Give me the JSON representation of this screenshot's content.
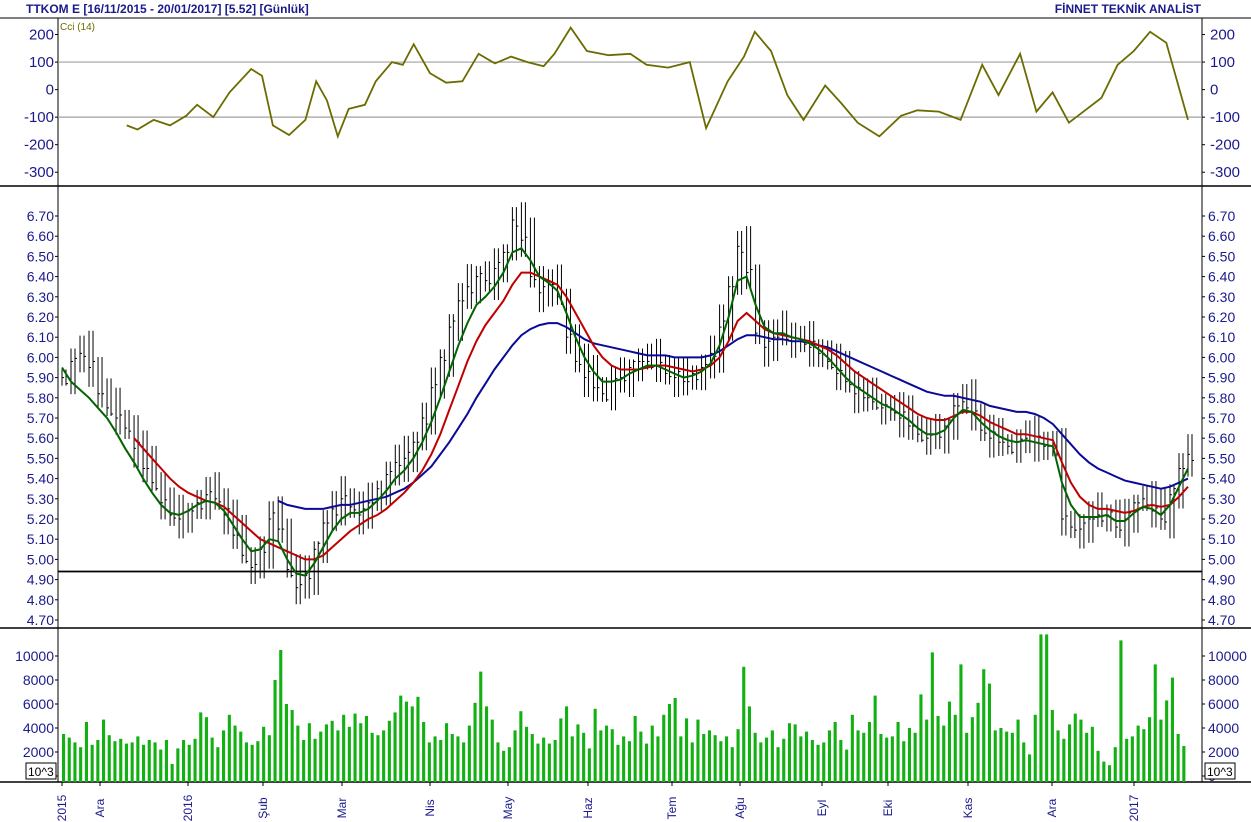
{
  "header": {
    "left_text": "TTKOM E  [16/11/2015 - 20/01/2017]  [5.52]  [Günlük]",
    "right_text": "FİNNET TEKNİK ANALİST"
  },
  "colors": {
    "cci": "#6b6b00",
    "price_bars": "#000000",
    "ma_short": "#006400",
    "ma_mid": "#c00000",
    "ma_long": "#0a0a96",
    "volume": "#12b012",
    "axis_text": "#1a1a8c",
    "grid": "#a0a0a0"
  },
  "chart_data": [
    {
      "type": "line",
      "name": "cci-panel",
      "title": "",
      "series_label": "Cci (14)",
      "ylim": [
        -350,
        260
      ],
      "y_ticks": [
        200,
        100,
        0,
        -100,
        -200,
        -300
      ],
      "grid_lines": [
        100,
        -100
      ],
      "series": [
        {
          "name": "Cci (14)",
          "values": [
            [
              0.02,
              -130
            ],
            [
              0.03,
              -145
            ],
            [
              0.045,
              -110
            ],
            [
              0.06,
              -130
            ],
            [
              0.075,
              -95
            ],
            [
              0.085,
              -55
            ],
            [
              0.1,
              -100
            ],
            [
              0.115,
              -10
            ],
            [
              0.135,
              75
            ],
            [
              0.145,
              50
            ],
            [
              0.155,
              -130
            ],
            [
              0.17,
              -165
            ],
            [
              0.185,
              -110
            ],
            [
              0.195,
              30
            ],
            [
              0.205,
              -40
            ],
            [
              0.215,
              -170
            ],
            [
              0.225,
              -70
            ],
            [
              0.24,
              -55
            ],
            [
              0.25,
              30
            ],
            [
              0.265,
              100
            ],
            [
              0.275,
              90
            ],
            [
              0.285,
              165
            ],
            [
              0.3,
              60
            ],
            [
              0.315,
              25
            ],
            [
              0.33,
              30
            ],
            [
              0.345,
              130
            ],
            [
              0.36,
              95
            ],
            [
              0.375,
              120
            ],
            [
              0.39,
              100
            ],
            [
              0.405,
              85
            ],
            [
              0.415,
              130
            ],
            [
              0.43,
              225
            ],
            [
              0.445,
              140
            ],
            [
              0.465,
              125
            ],
            [
              0.485,
              130
            ],
            [
              0.5,
              90
            ],
            [
              0.52,
              80
            ],
            [
              0.54,
              100
            ],
            [
              0.555,
              -140
            ],
            [
              0.575,
              30
            ],
            [
              0.59,
              120
            ],
            [
              0.6,
              210
            ],
            [
              0.615,
              140
            ],
            [
              0.63,
              -20
            ],
            [
              0.645,
              -110
            ],
            [
              0.665,
              15
            ],
            [
              0.68,
              -50
            ],
            [
              0.695,
              -120
            ],
            [
              0.715,
              -170
            ],
            [
              0.735,
              -95
            ],
            [
              0.75,
              -75
            ],
            [
              0.77,
              -80
            ],
            [
              0.79,
              -110
            ],
            [
              0.81,
              90
            ],
            [
              0.825,
              -20
            ],
            [
              0.845,
              130
            ],
            [
              0.86,
              -80
            ],
            [
              0.875,
              -10
            ],
            [
              0.89,
              -120
            ],
            [
              0.905,
              -75
            ],
            [
              0.92,
              -30
            ],
            [
              0.935,
              90
            ],
            [
              0.95,
              140
            ],
            [
              0.965,
              210
            ],
            [
              0.98,
              170
            ],
            [
              1.0,
              -110
            ]
          ],
          "x_fraction_note": ""
        }
      ]
    },
    {
      "type": "line",
      "name": "price-panel",
      "title": "",
      "ylim": [
        4.65,
        6.8
      ],
      "y_ticks": [
        "6.70",
        "6.60",
        "6.50",
        "6.40",
        "6.30",
        "6.20",
        "6.10",
        "6.00",
        "5.90",
        "5.80",
        "5.70",
        "5.60",
        "5.50",
        "5.40",
        "5.30",
        "5.20",
        "5.10",
        "5.00",
        "4.90",
        "4.80",
        "4.70"
      ],
      "support_line": 4.94,
      "x_labels": [
        "2015",
        "Ara",
        "2016",
        "Şub",
        "Mar",
        "Nis",
        "May",
        "Haz",
        "Tem",
        "Ağu",
        "Eyl",
        "Eki",
        "Kas",
        "Ara",
        "2017"
      ],
      "close": [
        5.9,
        5.98,
        6.02,
        5.95,
        5.82,
        5.75,
        5.7,
        5.65,
        5.55,
        5.45,
        5.38,
        5.28,
        5.22,
        5.2,
        5.24,
        5.28,
        5.32,
        5.3,
        5.22,
        5.12,
        5.02,
        4.96,
        5.05,
        5.2,
        5.15,
        4.95,
        4.86,
        4.92,
        5.05,
        5.18,
        5.25,
        5.3,
        5.26,
        5.22,
        5.28,
        5.35,
        5.42,
        5.48,
        5.5,
        5.58,
        5.7,
        5.85,
        6.0,
        6.15,
        6.28,
        6.35,
        6.4,
        6.38,
        6.44,
        6.52,
        6.68,
        6.58,
        6.4,
        6.32,
        6.36,
        6.3,
        6.1,
        5.98,
        5.9,
        5.85,
        5.82,
        5.88,
        5.9,
        5.95,
        5.98,
        5.98,
        5.96,
        5.92,
        5.9,
        5.88,
        5.92,
        5.95,
        6.02,
        6.15,
        6.35,
        6.55,
        6.42,
        6.12,
        6.05,
        6.1,
        6.12,
        6.08,
        6.08,
        6.05,
        6.02,
        5.98,
        5.92,
        5.88,
        5.82,
        5.8,
        5.78,
        5.75,
        5.74,
        5.7,
        5.66,
        5.62,
        5.6,
        5.62,
        5.66,
        5.76,
        5.78,
        5.72,
        5.64,
        5.6,
        5.58,
        5.56,
        5.58,
        5.6,
        5.58,
        5.56,
        5.55,
        5.2,
        5.16,
        5.15,
        5.2,
        5.22,
        5.22,
        5.16,
        5.2,
        5.28,
        5.3,
        5.24,
        5.2,
        5.32,
        5.45,
        5.52
      ],
      "series": [
        {
          "name": "",
          "role": "short",
          "values": [
            5.95,
            5.88,
            5.84,
            5.8,
            5.75,
            5.7,
            5.63,
            5.55,
            5.48,
            5.4,
            5.33,
            5.27,
            5.23,
            5.22,
            5.24,
            5.27,
            5.29,
            5.28,
            5.24,
            5.17,
            5.1,
            5.04,
            5.05,
            5.1,
            5.09,
            5.0,
            4.93,
            4.92,
            4.98,
            5.06,
            5.14,
            5.2,
            5.23,
            5.23,
            5.25,
            5.29,
            5.34,
            5.4,
            5.44,
            5.5,
            5.58,
            5.68,
            5.8,
            5.93,
            6.06,
            6.17,
            6.26,
            6.3,
            6.35,
            6.42,
            6.52,
            6.54,
            6.48,
            6.4,
            6.37,
            6.33,
            6.22,
            6.1,
            6.0,
            5.93,
            5.88,
            5.88,
            5.89,
            5.92,
            5.94,
            5.96,
            5.96,
            5.94,
            5.92,
            5.9,
            5.91,
            5.93,
            5.97,
            6.06,
            6.2,
            6.38,
            6.4,
            6.26,
            6.15,
            6.12,
            6.12,
            6.1,
            6.09,
            6.07,
            6.04,
            6.0,
            5.95,
            5.9,
            5.86,
            5.83,
            5.8,
            5.77,
            5.75,
            5.72,
            5.69,
            5.65,
            5.62,
            5.62,
            5.64,
            5.7,
            5.74,
            5.73,
            5.68,
            5.64,
            5.61,
            5.59,
            5.58,
            5.59,
            5.58,
            5.57,
            5.56,
            5.38,
            5.27,
            5.21,
            5.21,
            5.21,
            5.22,
            5.19,
            5.19,
            5.23,
            5.26,
            5.25,
            5.22,
            5.27,
            5.36,
            5.45
          ]
        },
        {
          "name": "",
          "role": "mid",
          "values": [
            null,
            null,
            null,
            null,
            null,
            null,
            null,
            null,
            5.6,
            5.55,
            5.5,
            5.45,
            5.4,
            5.36,
            5.33,
            5.31,
            5.29,
            5.28,
            5.26,
            5.22,
            5.18,
            5.14,
            5.1,
            5.08,
            5.06,
            5.04,
            5.02,
            5.0,
            5.0,
            5.02,
            5.06,
            5.1,
            5.14,
            5.17,
            5.2,
            5.22,
            5.25,
            5.29,
            5.33,
            5.38,
            5.44,
            5.52,
            5.62,
            5.74,
            5.86,
            5.98,
            6.08,
            6.16,
            6.22,
            6.28,
            6.36,
            6.42,
            6.42,
            6.4,
            6.38,
            6.36,
            6.3,
            6.22,
            6.14,
            6.06,
            6.0,
            5.96,
            5.94,
            5.94,
            5.94,
            5.95,
            5.96,
            5.96,
            5.95,
            5.94,
            5.93,
            5.94,
            5.96,
            6.0,
            6.08,
            6.18,
            6.22,
            6.18,
            6.14,
            6.12,
            6.11,
            6.1,
            6.09,
            6.08,
            6.06,
            6.04,
            6.01,
            5.97,
            5.93,
            5.9,
            5.87,
            5.84,
            5.81,
            5.78,
            5.75,
            5.72,
            5.7,
            5.69,
            5.69,
            5.71,
            5.73,
            5.73,
            5.71,
            5.68,
            5.66,
            5.64,
            5.62,
            5.62,
            5.61,
            5.6,
            5.59,
            5.48,
            5.38,
            5.31,
            5.27,
            5.25,
            5.25,
            5.24,
            5.23,
            5.24,
            5.26,
            5.27,
            5.26,
            5.27,
            5.31,
            5.36
          ]
        },
        {
          "name": "",
          "role": "long",
          "values": [
            null,
            null,
            null,
            null,
            null,
            null,
            null,
            null,
            null,
            null,
            null,
            null,
            null,
            null,
            null,
            null,
            null,
            null,
            null,
            null,
            null,
            null,
            null,
            null,
            5.29,
            5.27,
            5.26,
            5.25,
            5.25,
            5.25,
            5.26,
            5.27,
            5.27,
            5.28,
            5.29,
            5.3,
            5.31,
            5.33,
            5.35,
            5.38,
            5.42,
            5.46,
            5.52,
            5.58,
            5.65,
            5.72,
            5.8,
            5.87,
            5.94,
            6.0,
            6.06,
            6.11,
            6.14,
            6.16,
            6.17,
            6.17,
            6.15,
            6.12,
            6.09,
            6.07,
            6.06,
            6.05,
            6.04,
            6.03,
            6.02,
            6.01,
            6.01,
            6.01,
            6.0,
            6.0,
            6.0,
            6.0,
            6.01,
            6.03,
            6.06,
            6.09,
            6.11,
            6.11,
            6.1,
            6.09,
            6.09,
            6.08,
            6.08,
            6.07,
            6.06,
            6.05,
            6.03,
            6.01,
            5.99,
            5.97,
            5.95,
            5.93,
            5.91,
            5.89,
            5.87,
            5.85,
            5.83,
            5.82,
            5.81,
            5.81,
            5.8,
            5.79,
            5.78,
            5.76,
            5.75,
            5.74,
            5.73,
            5.73,
            5.72,
            5.7,
            5.67,
            5.62,
            5.57,
            5.52,
            5.48,
            5.45,
            5.43,
            5.41,
            5.39,
            5.38,
            5.37,
            5.36,
            5.35,
            5.36,
            5.38,
            5.4
          ]
        }
      ]
    },
    {
      "type": "bar",
      "name": "volume-panel",
      "title": "",
      "unit_label": "10^3",
      "ylim": [
        0,
        11800
      ],
      "y_ticks": [
        10000,
        8000,
        6000,
        4000,
        2000,
        0
      ],
      "values": [
        3500,
        3200,
        2800,
        2400,
        4500,
        2600,
        3000,
        4700,
        3400,
        2900,
        3100,
        2700,
        2800,
        3300,
        2600,
        3000,
        2800,
        2200,
        3000,
        1000,
        2300,
        3000,
        2600,
        3100,
        5300,
        4900,
        3200,
        2400,
        3800,
        5100,
        4200,
        3700,
        2800,
        2600,
        2900,
        4100,
        3400,
        8000,
        10500,
        6000,
        5500,
        4200,
        3000,
        4400,
        3100,
        3700,
        4300,
        4600,
        3800,
        5100,
        4100,
        5200,
        4400,
        5000,
        3600,
        3400,
        3800,
        4600,
        5300,
        6700,
        6200,
        5800,
        6600,
        4500,
        2800,
        3300,
        3000,
        4400,
        3500,
        3300,
        2800,
        4200,
        6100,
        8700,
        5800,
        4700,
        2800,
        2100,
        2400,
        3800,
        5400,
        4100,
        3500,
        2700,
        3200,
        2700,
        3000,
        4800,
        5800,
        3300,
        4300,
        3600,
        2300,
        5600,
        3800,
        4200,
        3900,
        2600,
        3300,
        2900,
        5000,
        3700,
        2700,
        4200,
        3300,
        5100,
        6000,
        6500,
        3300,
        4800,
        2800,
        4700,
        3500,
        3800,
        3400,
        2900,
        3300,
        2400,
        3900,
        9100,
        5800,
        3600,
        2800,
        3200,
        3800,
        2400,
        3100,
        4400,
        4300,
        3300,
        3700,
        3000,
        2600,
        2800,
        3800,
        4500,
        3000,
        2200,
        5100,
        3800,
        3600,
        4500,
        6700,
        3500,
        3200,
        3300,
        4500,
        2900,
        4000,
        3600,
        6800,
        4700,
        10300,
        5000,
        4200,
        6200,
        5100,
        9300,
        3600,
        4900,
        6100,
        8900,
        7700,
        3800,
        4000,
        3700,
        3600,
        4700,
        2800,
        1800,
        5100,
        11800,
        12100,
        5500,
        3800,
        3100,
        4300,
        5200,
        4700,
        3600,
        4100,
        2100,
        1200,
        900,
        2400,
        11300,
        3100,
        3300,
        4200,
        3900,
        4900,
        9300,
        4700,
        6300,
        8200,
        3500,
        2500
      ]
    }
  ]
}
